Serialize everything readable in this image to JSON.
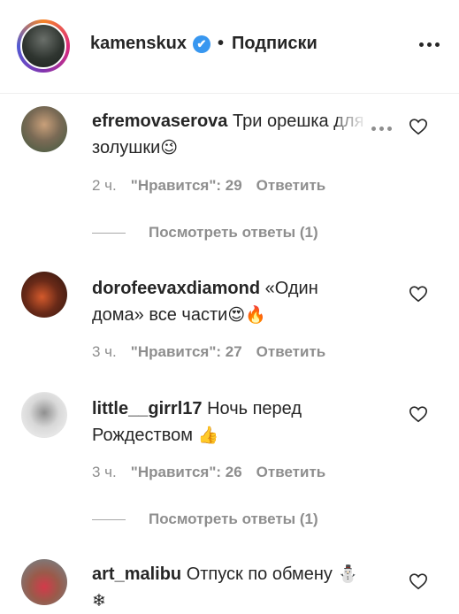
{
  "header": {
    "username": "kamenskux",
    "verified_mark": "✔",
    "separator": "•",
    "follow_status": "Подписки"
  },
  "comments": [
    {
      "username": "efremovaserova",
      "text": "Три орешка для золушки",
      "emoji": "😉",
      "time": "2 ч.",
      "likes": "\"Нравится\": 29",
      "reply": "Ответить",
      "view_replies": "Посмотреть ответы (1)"
    },
    {
      "username": "dorofeevaxdiamond",
      "text": "«Один дома» все части",
      "emoji": "😍🔥",
      "time": "3 ч.",
      "likes": "\"Нравится\": 27",
      "reply": "Ответить"
    },
    {
      "username": "little__girrl17",
      "text": "Ночь перед Рождеством",
      "emoji": "👍",
      "time": "3 ч.",
      "likes": "\"Нравится\": 26",
      "reply": "Ответить",
      "view_replies": "Посмотреть ответы (1)"
    },
    {
      "username": "art_malibu",
      "text": "Отпуск по обмену",
      "emoji": "⛄ ❄",
      "time": "",
      "likes": "",
      "reply": ""
    }
  ],
  "icons": {
    "heart": "heart-outline-icon",
    "more": "more-horizontal-icon",
    "verified": "verified-badge-icon"
  },
  "colors": {
    "text": "#262626",
    "secondary": "#8e8e8e",
    "verified": "#3897f0",
    "divider": "#efefef"
  }
}
